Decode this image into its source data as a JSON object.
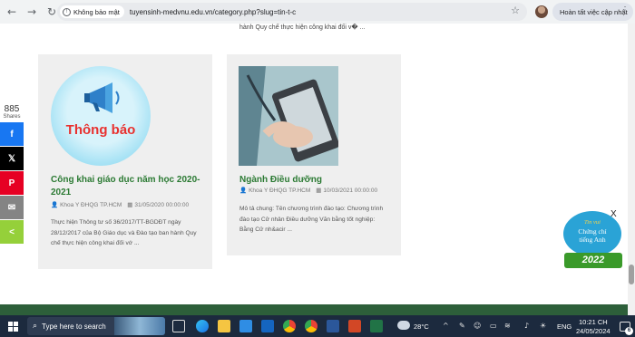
{
  "browser": {
    "back_icon": "back-arrow-icon",
    "forward_icon": "forward-arrow-icon",
    "reload_icon": "reload-icon",
    "security_chip": "Không bảo mật",
    "url": "tuyensinh-medvnu.edu.vn/category.php?slug=tin-t-c",
    "update_button": "Hoàn tất việc cập nhật"
  },
  "page": {
    "top_excerpt": "hành Quy chế thực hiện công khai đối v� ..."
  },
  "share_bar": {
    "count": "885",
    "count_label": "Shares",
    "facebook": "f",
    "x": "𝕏",
    "pinterest": "P",
    "email": "✉",
    "share": "<"
  },
  "posts": [
    {
      "thumb_text": "Thông báo",
      "title": "Công khai giáo dục năm học 2020-2021",
      "author": "Khoa Y ĐHQG TP.HCM",
      "date": "31/05/2020 00:00:00",
      "excerpt": "Thực hiện Thông tư số 36/2017/TT-BGDĐT ngày 28/12/2017 của Bộ Giáo dục và Đào tạo ban hành Quy chế thực hiện công khai đối vớ ..."
    },
    {
      "title": "Ngành Điều dưỡng",
      "author": "Khoa Y ĐHQG TP.HCM",
      "date": "10/03/2021 00:00:00",
      "excerpt": "Mô tả chung: Tên chương trình đào tạo: Chương trình đào tạo Cử nhân Điều dưỡng  Văn bằng tốt nghiệp: Bằng Cử nh&acir ..."
    }
  ],
  "badge": {
    "top": "Tin vui",
    "line1": "Chứng chỉ",
    "line2": "tiếng Anh",
    "year": "2022",
    "close": "X"
  },
  "taskbar": {
    "search_placeholder": "Type here to search",
    "temperature": "28°C",
    "language": "ENG",
    "time": "10:21 CH",
    "date": "24/05/2024",
    "notification_count": "6"
  },
  "colors": {
    "post_title": "#2b7a33",
    "card_bg": "#efefef",
    "footer": "#2d5f3a",
    "taskbar": "#1c2a3e"
  }
}
